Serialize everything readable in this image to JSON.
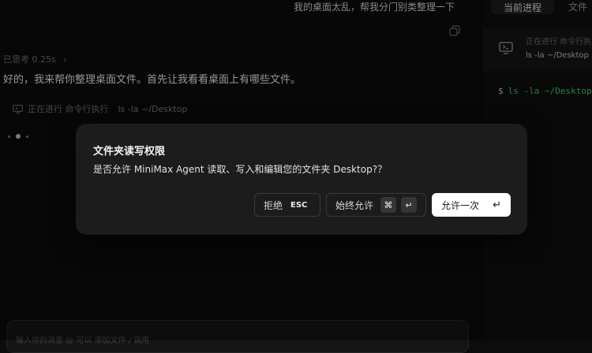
{
  "chat": {
    "user_message": "我的桌面太乱，帮我分门别类整理一下",
    "thought_label": "已思考 0.25s",
    "thought_chevron": "›",
    "reply": "好的，我来帮你整理桌面文件。首先让我看看桌面上有哪些文件。",
    "tool_status": "正在进行 命令行执行",
    "tool_command": "ls -la ~/Desktop"
  },
  "right_panel": {
    "tab_active": "当前进程",
    "tab_file": "文件",
    "status": "正在进行 命令行执",
    "command": "ls -la ~/Desktop",
    "terminal_prompt": "$",
    "terminal_command": "ls -la ~/Desktop"
  },
  "input": {
    "placeholder": "输入你的消息 @ 可以 添加文件 / 调用"
  },
  "dialog": {
    "title": "文件夹读写权限",
    "message": "是否允许 MiniMax Agent 读取、写入和编辑您的文件夹 Desktop?？",
    "deny_label": "拒绝",
    "deny_key": "ESC",
    "always_label": "始终允许",
    "always_key_cmd": "⌘",
    "always_key_enter": "↵",
    "once_label": "允许一次",
    "once_key_enter": "↵"
  },
  "colors": {
    "terminal_green": "#3ec26a",
    "dialog_bg": "#1c1c1c",
    "primary_button": "#ffffff"
  },
  "icons": [
    "copy-icon",
    "terminal-icon",
    "monitor-icon",
    "chevron-right-icon",
    "command-key-icon",
    "enter-key-icon"
  ]
}
